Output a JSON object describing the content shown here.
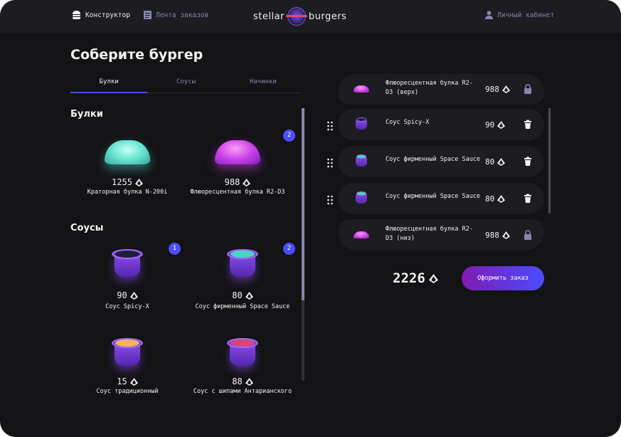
{
  "header": {
    "constructor_label": "Конструктор",
    "feed_label": "Лента заказов",
    "logo_left": "stellar",
    "logo_right": "burgers",
    "account_label": "Личный кабинет"
  },
  "main": {
    "title": "Соберите бургер",
    "tabs": [
      {
        "label": "Булки",
        "active": true
      },
      {
        "label": "Соусы",
        "active": false
      },
      {
        "label": "Начинки",
        "active": false
      }
    ]
  },
  "sections": {
    "buns": {
      "title": "Булки",
      "items": [
        {
          "name": "Краторная булка N-200i",
          "price": "1255",
          "count": null
        },
        {
          "name": "Флюоресцентная булка R2-D3",
          "price": "988",
          "count": "2"
        }
      ]
    },
    "sauces": {
      "title": "Соусы",
      "items": [
        {
          "name": "Соус Spicy-X",
          "price": "90",
          "count": "1"
        },
        {
          "name": "Соус фирменный Space Sauce",
          "price": "80",
          "count": "2"
        },
        {
          "name": "Соус традиционный",
          "price": "15",
          "count": null
        },
        {
          "name": "Соус с шипами Антарианского",
          "price": "88",
          "count": null
        }
      ]
    }
  },
  "constructor": {
    "top": {
      "name": "Флюоресцентная булка R2-D3 (верх)",
      "price": "988",
      "icon": "lock-icon"
    },
    "fillings": [
      {
        "name": "Соус Spicy-X",
        "price": "90",
        "icon": "trash-icon"
      },
      {
        "name": "Соус фирменный Space Sauce",
        "price": "80",
        "icon": "trash-icon"
      },
      {
        "name": "Соус фирменный Space Sauce",
        "price": "80",
        "icon": "trash-icon"
      }
    ],
    "bottom": {
      "name": "Флюоресцентная булка R2-D3 (низ)",
      "price": "988",
      "icon": "lock-icon"
    }
  },
  "order": {
    "total": "2226",
    "button_label": "Оформить заказ"
  },
  "colors": {
    "accent": "#4c4cff",
    "background": "#131316",
    "panel": "#1c1c21",
    "inactive_text": "#8585ad"
  }
}
